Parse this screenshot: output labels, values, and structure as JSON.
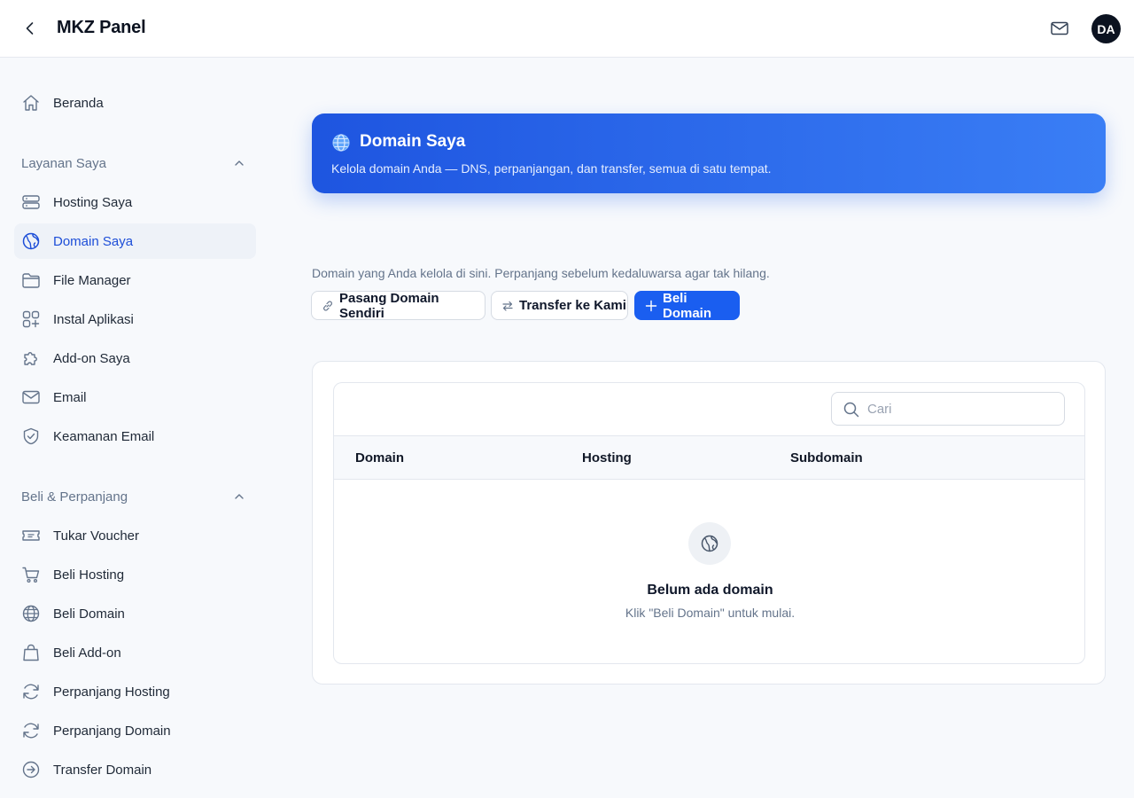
{
  "header": {
    "title": "MKZ Panel",
    "avatar_initials": "DA"
  },
  "sidebar": {
    "home": {
      "label": "Beranda",
      "icon": "home-icon"
    },
    "sections": [
      {
        "title": "Layanan Saya",
        "items": [
          {
            "label": "Hosting Saya",
            "icon": "server-icon"
          },
          {
            "label": "Domain Saya",
            "icon": "globe-icon",
            "active": true
          },
          {
            "label": "File Manager",
            "icon": "folder-icon"
          },
          {
            "label": "Instal Aplikasi",
            "icon": "apps-icon"
          },
          {
            "label": "Add-on Saya",
            "icon": "puzzle-icon"
          },
          {
            "label": "Email",
            "icon": "mail-icon"
          },
          {
            "label": "Keamanan Email",
            "icon": "shield-icon"
          }
        ]
      },
      {
        "title": "Beli & Perpanjang",
        "items": [
          {
            "label": "Tukar Voucher",
            "icon": "ticket-icon"
          },
          {
            "label": "Beli Hosting",
            "icon": "cart-icon"
          },
          {
            "label": "Beli Domain",
            "icon": "globe-icon"
          },
          {
            "label": "Beli Add-on",
            "icon": "bag-icon"
          },
          {
            "label": "Perpanjang Hosting",
            "icon": "refresh-icon"
          },
          {
            "label": "Perpanjang Domain",
            "icon": "refresh-icon"
          },
          {
            "label": "Transfer Domain",
            "icon": "arrow-circle-icon"
          }
        ]
      }
    ]
  },
  "hero": {
    "title": "Domain Saya",
    "subtitle": "Kelola domain Anda — DNS, perpanjangan, dan transfer, semua di satu tempat."
  },
  "main": {
    "description": "Domain yang Anda kelola di sini. Perpanjang sebelum kedaluwarsa agar tak hilang.",
    "buttons": {
      "connect": "Pasang Domain Sendiri",
      "transfer": "Transfer ke Kami",
      "buy": "Beli Domain"
    }
  },
  "table": {
    "search_placeholder": "Cari",
    "columns": [
      "Domain",
      "Hosting",
      "Subdomain"
    ],
    "rows": [],
    "empty_title": "Belum ada domain",
    "empty_subtitle": "Klik \"Beli Domain\" untuk mulai."
  },
  "colors": {
    "accent": "#1a5ef0",
    "active_nav_text": "#1d4ed8",
    "hero_gradient_start": "#1e55e0",
    "hero_gradient_end": "#3a7ef5"
  }
}
